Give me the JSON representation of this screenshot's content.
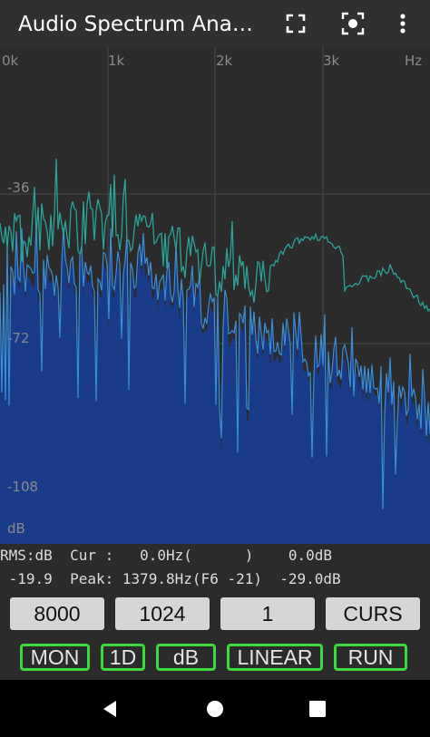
{
  "app_bar": {
    "title": "Audio Spectrum Ana…",
    "icons": [
      "fullscreen-icon",
      "screenshot-icon",
      "more-vert-icon"
    ]
  },
  "spectrum": {
    "x_ticks": [
      "0k",
      "1k",
      "2k",
      "3k"
    ],
    "x_unit": "Hz",
    "y_ticks": [
      "-36",
      "-72",
      "-108"
    ],
    "y_unit": "dB",
    "colors": {
      "background": "#2b2b2b",
      "bars": "#1a3a8a",
      "spectrum_line": "#3a8fd8",
      "peak_hold": "#2aa39a",
      "grid": "#4a4a4a"
    }
  },
  "readout": {
    "line1": "RMS:dB  Cur :   0.0Hz(      )    0.0dB",
    "line2": " -19.9  Peak: 1379.8Hz(F6 -21)  -29.0dB"
  },
  "controls": {
    "buttons": [
      "8000",
      "1024",
      "1",
      "CURS"
    ],
    "modes": [
      "MON",
      "1D",
      "dB",
      "LINEAR",
      "RUN"
    ],
    "accent": "#3adb3a"
  },
  "nav": {
    "icons": [
      "back-icon",
      "home-icon",
      "recents-icon"
    ]
  }
}
